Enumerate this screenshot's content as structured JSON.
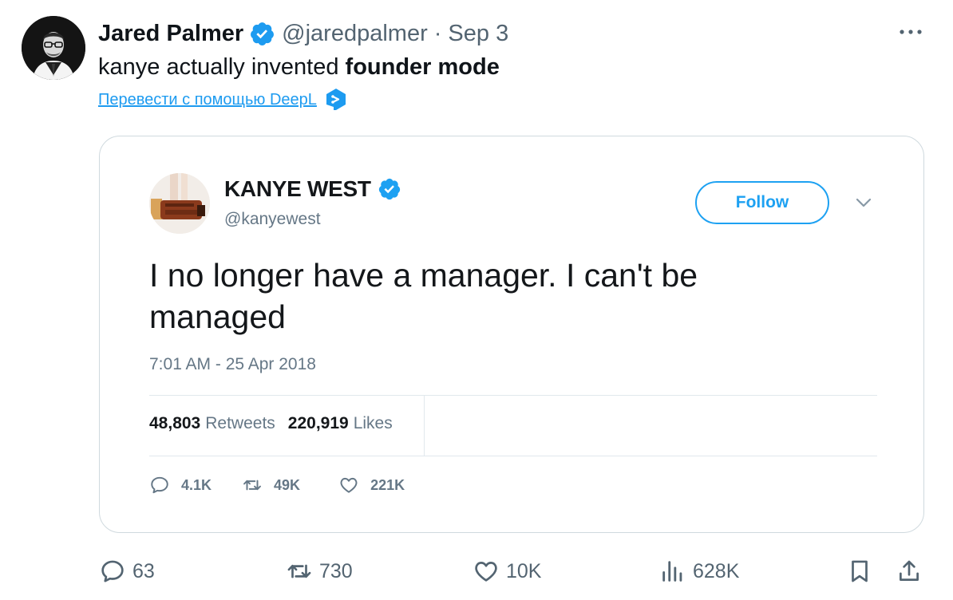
{
  "tweet": {
    "author_name": "Jared Palmer",
    "handle": "@jaredpalmer",
    "separator": "·",
    "date": "Sep 3",
    "text_before": "kanye actually invented ",
    "text_bold": "founder mode",
    "translate_link": "Перевести с помощью DeepL",
    "icons": {
      "verified": "verified-badge-icon",
      "more": "more-options-icon",
      "deepl": "deepl-icon"
    },
    "accent_color": "#1d9bf0"
  },
  "embedded_tweet": {
    "name": "KANYE WEST",
    "handle": "@kanyewest",
    "follow_label": "Follow",
    "text": "I no longer have a manager. I can't be managed",
    "timestamp": "7:01 AM - 25 Apr 2018",
    "retweets_count": "48,803",
    "retweets_label": "Retweets",
    "likes_count": "220,919",
    "likes_label": "Likes",
    "actions": [
      {
        "icon": "reply-icon",
        "count": "4.1K"
      },
      {
        "icon": "retweet-icon",
        "count": "49K"
      },
      {
        "icon": "heart-icon",
        "count": "221K"
      }
    ]
  },
  "actions": {
    "replies": "63",
    "reposts": "730",
    "likes": "10K",
    "views": "628K",
    "icons": [
      "reply-icon",
      "repost-icon",
      "like-icon",
      "views-icon",
      "bookmark-icon",
      "share-icon"
    ]
  }
}
